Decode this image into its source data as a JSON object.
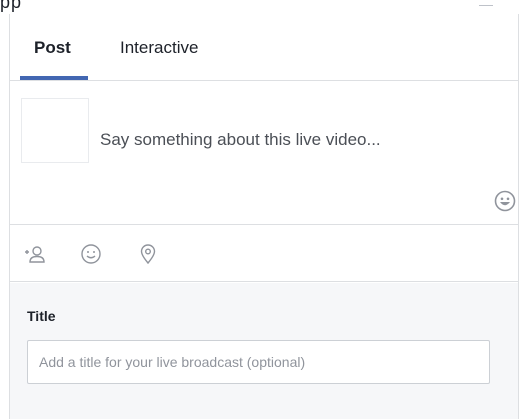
{
  "header": {
    "cutoff_text": "pp"
  },
  "tabs": [
    {
      "label": "Post",
      "active": true
    },
    {
      "label": "Interactive",
      "active": false
    }
  ],
  "composer": {
    "placeholder": "Say something about this live video..."
  },
  "actions": [
    {
      "icon": "tag-people-icon"
    },
    {
      "icon": "feeling-icon"
    },
    {
      "icon": "location-pin-icon"
    }
  ],
  "title_section": {
    "label": "Title",
    "placeholder": "Add a title for your live broadcast (optional)",
    "value": ""
  },
  "colors": {
    "accent": "#4267b2",
    "border": "#dddfe2",
    "section_bg": "#f6f7f9",
    "text": "#1d2129",
    "muted_text": "#4b4f56",
    "placeholder": "#90949c",
    "icon": "#90949c"
  }
}
